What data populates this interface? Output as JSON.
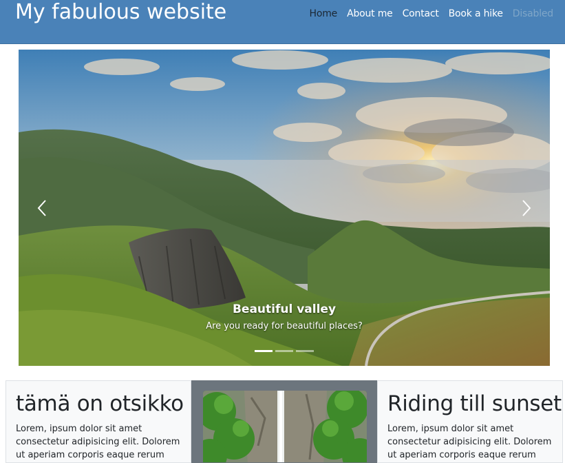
{
  "header": {
    "brand": "My fabulous website",
    "nav": [
      {
        "label": "Home",
        "state": "active"
      },
      {
        "label": "About me",
        "state": "normal"
      },
      {
        "label": "Contact",
        "state": "normal"
      },
      {
        "label": "Book a hike",
        "state": "normal"
      },
      {
        "label": "Disabled",
        "state": "disabled"
      }
    ]
  },
  "carousel": {
    "caption_title": "Beautiful valley",
    "caption_text": "Are you ready for beautiful places?",
    "prev_icon": "chevron-left-icon",
    "next_icon": "chevron-right-icon",
    "slide_count": 3,
    "active_slide": 1
  },
  "cards": [
    {
      "title": "tämä on otsikko",
      "text": "Lorem, ipsum dolor sit amet consectetur adipisicing elit. Dolorem ut aperiam corporis eaque rerum nihil, placeat, fugiat"
    },
    {
      "image": "waterfall-photo"
    },
    {
      "title": "Riding till sunset",
      "text": "Lorem, ipsum dolor sit amet consectetur adipisicing elit. Dolorem ut aperiam corporis eaque rerum nihil, placeat, fugiat"
    }
  ],
  "colors": {
    "navbar": "#4a82b8",
    "nav_active": "#1b2733",
    "nav_disabled": "#7fa6c8",
    "card_bg": "#f8f9fa",
    "card_dark": "#6c757d"
  }
}
